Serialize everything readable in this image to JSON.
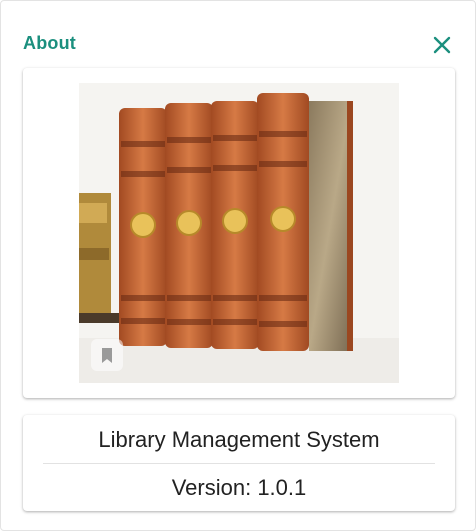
{
  "dialog": {
    "title": "About",
    "close_icon": "close-icon"
  },
  "image": {
    "subject": "books-photo",
    "bookmark_icon": "bookmark-icon"
  },
  "info": {
    "app_name": "Library Management System",
    "version": "Version: 1.0.1"
  },
  "colors": {
    "accent": "#1b8f7e",
    "text": "#222222",
    "divider": "#e2e2e2"
  }
}
